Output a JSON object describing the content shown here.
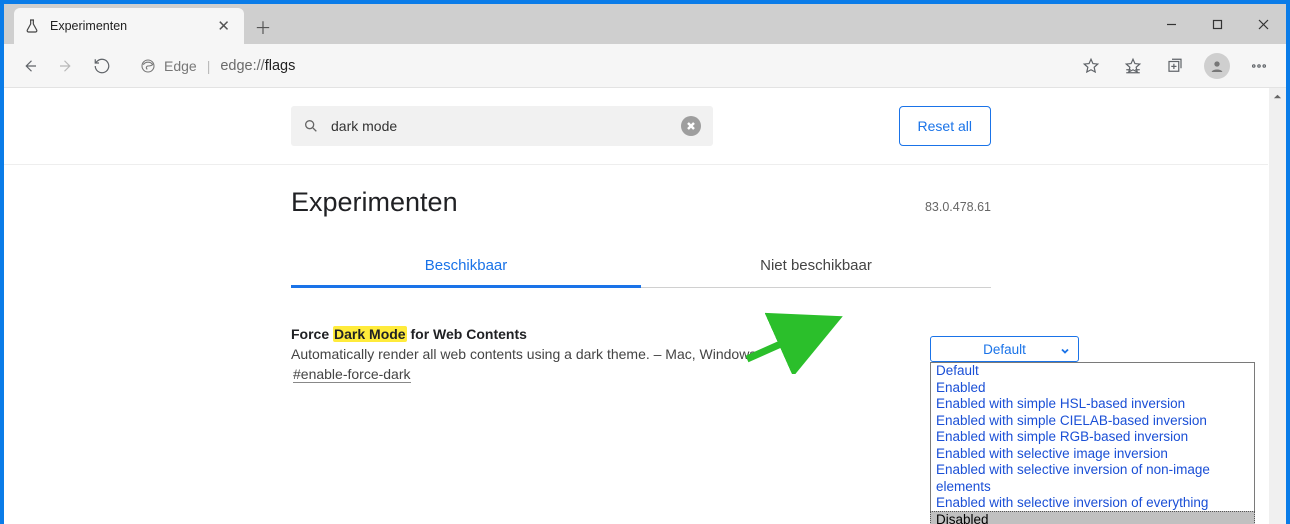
{
  "tab": {
    "title": "Experimenten"
  },
  "omnibox": {
    "edge_label": "Edge",
    "url_prefix": "edge://",
    "url_bold": "flags"
  },
  "topbar": {
    "reset_label": "Reset all"
  },
  "search": {
    "value": "dark mode"
  },
  "page": {
    "heading": "Experimenten",
    "version": "83.0.478.61"
  },
  "tabs": {
    "available": "Beschikbaar",
    "unavailable": "Niet beschikbaar"
  },
  "flag": {
    "title_prefix": "Force ",
    "title_highlight": "Dark Mode",
    "title_suffix": " for Web Contents",
    "description": "Automatically render all web contents using a dark theme. – Mac, Windows",
    "hash": "#enable-force-dark",
    "selected": "Default",
    "options": [
      "Default",
      "Enabled",
      "Enabled with simple HSL-based inversion",
      "Enabled with simple CIELAB-based inversion",
      "Enabled with simple RGB-based inversion",
      "Enabled with selective image inversion",
      "Enabled with selective inversion of non-image elements",
      "Enabled with selective inversion of everything",
      "Disabled"
    ]
  }
}
